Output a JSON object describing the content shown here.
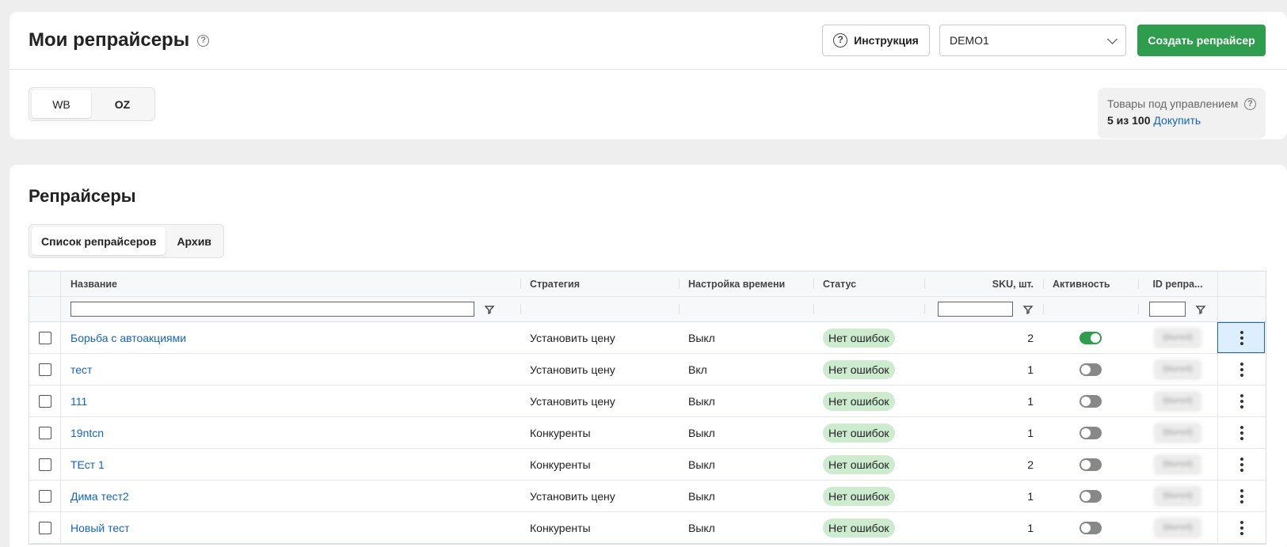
{
  "header": {
    "title": "Мои репрайсеры",
    "instruction_label": "Инструкция",
    "account_value": "DEMO1",
    "create_label": "Создать репрайсер"
  },
  "marketplace_tabs": [
    "WB",
    "OZ"
  ],
  "quota": {
    "title": "Товары под управлением",
    "count": "5 из 100",
    "buy_more": "Докупить"
  },
  "section": {
    "title": "Репрайсеры",
    "tabs": [
      "Список репрайсеров",
      "Архив"
    ]
  },
  "table": {
    "columns": [
      "Название",
      "Стратегия",
      "Настройка времени",
      "Статус",
      "SKU, шт.",
      "Активность",
      "ID репра..."
    ],
    "rows": [
      {
        "name": "Борьба с автоакциями",
        "strategy": "Установить цену",
        "time": "Выкл",
        "status": "Нет ошибок",
        "sku": "2",
        "active": true,
        "id": "(blurred)"
      },
      {
        "name": "тест",
        "strategy": "Установить цену",
        "time": "Вкл",
        "status": "Нет ошибок",
        "sku": "1",
        "active": false,
        "id": "(blurred)"
      },
      {
        "name": "111",
        "strategy": "Установить цену",
        "time": "Выкл",
        "status": "Нет ошибок",
        "sku": "1",
        "active": false,
        "id": "(blurred)"
      },
      {
        "name": "19ntcn",
        "strategy": "Конкуренты",
        "time": "Выкл",
        "status": "Нет ошибок",
        "sku": "1",
        "active": false,
        "id": "(blurred)"
      },
      {
        "name": "ТЕст 1",
        "strategy": "Конкуренты",
        "time": "Выкл",
        "status": "Нет ошибок",
        "sku": "2",
        "active": false,
        "id": "(blurred)"
      },
      {
        "name": "Дима тест2",
        "strategy": "Установить цену",
        "time": "Выкл",
        "status": "Нет ошибок",
        "sku": "1",
        "active": false,
        "id": "(blurred)"
      },
      {
        "name": "Новый тест",
        "strategy": "Конкуренты",
        "time": "Выкл",
        "status": "Нет ошибок",
        "sku": "1",
        "active": false,
        "id": "(blurred)"
      }
    ]
  },
  "colors": {
    "accent_green": "#2e9e4e",
    "link_blue": "#1565c0",
    "status_bg": "#cdeccf"
  },
  "icons": [
    "help-icon",
    "chevron-down-icon",
    "filter-icon",
    "kebab-menu-icon",
    "toggle-switch-icon"
  ]
}
